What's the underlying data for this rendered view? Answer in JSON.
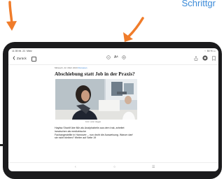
{
  "background": {
    "heading_fragment": "Schrittgr",
    "accent_color": "#f07c2a",
    "heading_color": "#3a8ad8"
  },
  "statusbar": {
    "time": "11:35 Mi. 22. März",
    "right": "⌔ 50 % ▭"
  },
  "toolbar": {
    "back_label": "Zurück",
    "back_icon": "chevron-left-icon",
    "grid_icon": "grid-icon",
    "minus_icon": "zoom-out-icon",
    "font_size_label": "Aᴬ",
    "plus_icon": "zoom-in-icon",
    "share_icon": "share-icon",
    "settings_icon": "settings-icon",
    "bookmark_icon": "bookmark-icon"
  },
  "article": {
    "meta_prefix": "Mittwoch, 22. März 2023",
    "meta_tag": "Personen",
    "headline": "Abschiebung statt Job in der Praxis?",
    "caption": "Foto: Leiter Haggle",
    "body_lines": [
      "Hayfaa Shariif übe flüh als Analphabetin aus dem Irak, arbeitet",
      "inzwischen als medizinische",
      "Fachangestellte in Hannover – nun droht die Ausweisung. Warum darf",
      "sie nicht bleiben? Weiter auf Seite 19"
    ]
  },
  "bottom_nav": {
    "left_glyph": "‹",
    "center_glyph": "○",
    "right_glyph": "☰"
  }
}
